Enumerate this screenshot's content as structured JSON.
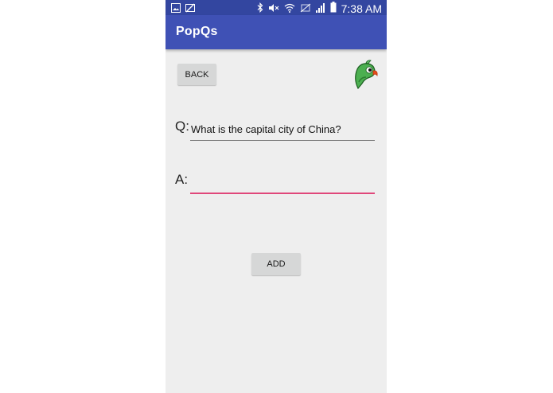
{
  "status_bar": {
    "time": "7:38 AM",
    "icons": [
      "photo-icon",
      "image-crossed-icon",
      "bluetooth-icon",
      "mute-icon",
      "wifi-icon",
      "no-sim-icon",
      "signal-icon",
      "battery-icon"
    ]
  },
  "app_bar": {
    "title": "PopQs"
  },
  "buttons": {
    "back_label": "BACK",
    "add_label": "ADD"
  },
  "form": {
    "question_label": "Q:",
    "question_value": "What is the capital city of China?",
    "answer_label": "A:",
    "answer_value": ""
  },
  "colors": {
    "status_bar": "#3346a0",
    "app_bar": "#3f51b5",
    "background": "#eeeeee",
    "accent_underline": "#e0477a",
    "button": "#d6d7d7"
  }
}
